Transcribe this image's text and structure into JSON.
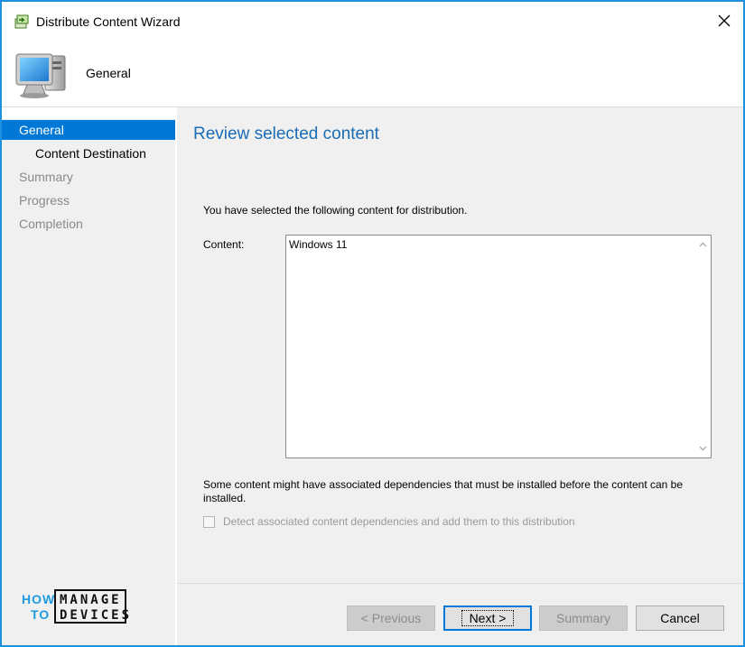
{
  "window": {
    "title": "Distribute Content Wizard"
  },
  "header": {
    "title": "General",
    "icon": "computer-icon"
  },
  "nav": {
    "items": [
      {
        "label": "General",
        "active": true
      },
      {
        "label": "Content Destination"
      },
      {
        "label": "Summary"
      },
      {
        "label": "Progress"
      },
      {
        "label": "Completion"
      }
    ]
  },
  "main": {
    "title": "Review selected content",
    "intro": "You have selected the following content for distribution.",
    "content_label": "Content:",
    "content_value": "Windows 11",
    "dependency_note": "Some content might have associated dependencies that must be installed before the content can be installed.",
    "dependency_checkbox_label": "Detect associated content dependencies and add them to this distribution"
  },
  "buttons": {
    "previous": "< Previous",
    "next": "Next >",
    "summary": "Summary",
    "cancel": "Cancel"
  },
  "logo": {
    "line1a": "HOW",
    "line1b": "MANAGE",
    "line2a": "TO",
    "line2b": "DEVICES"
  },
  "colors": {
    "accent": "#0078d7",
    "title_blue": "#1a6cb5",
    "border_blue": "#1e90e0"
  }
}
